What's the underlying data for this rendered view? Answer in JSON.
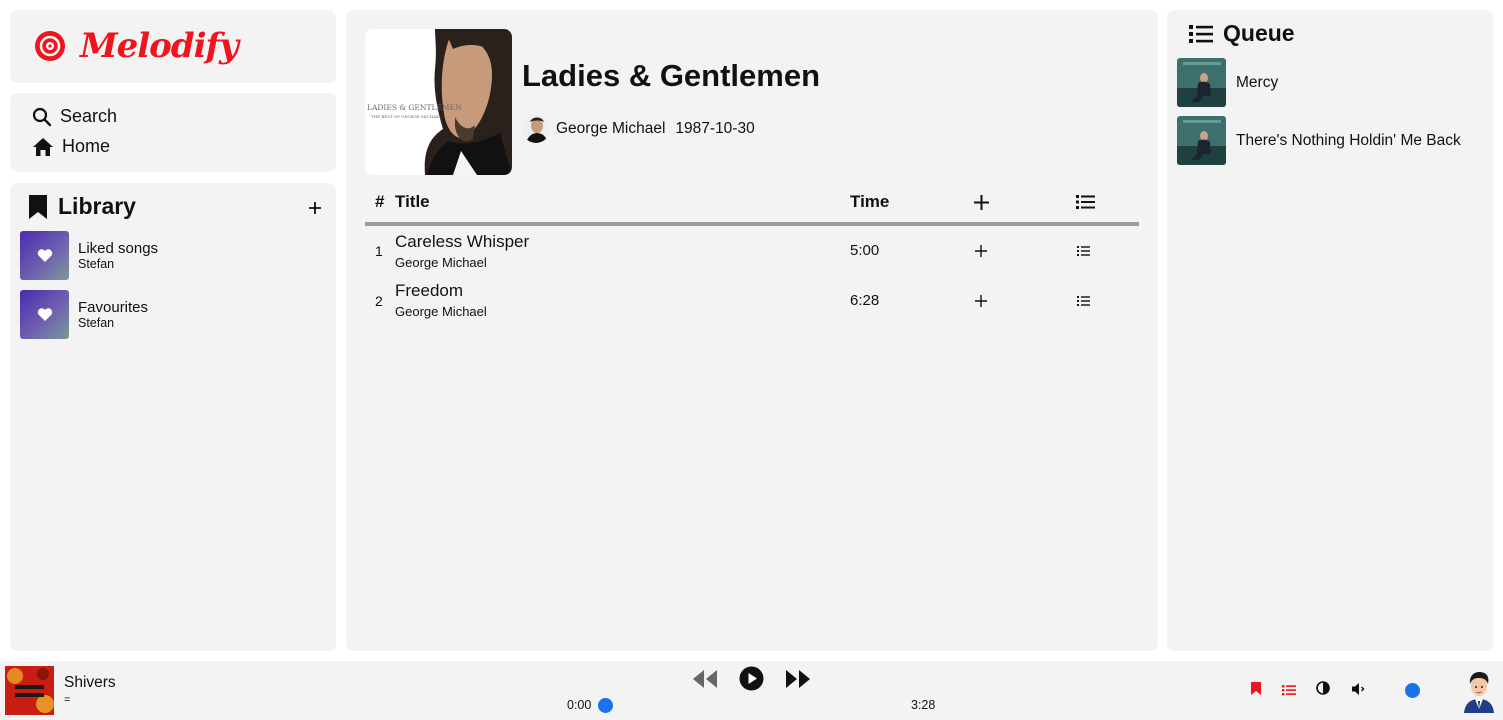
{
  "app": {
    "name": "Melodify",
    "brand_color": "#f0141e",
    "accent_color": "#1a73e8"
  },
  "nav": {
    "search_label": "Search",
    "home_label": "Home"
  },
  "library": {
    "title": "Library",
    "add_icon": "plus-icon",
    "playlists": [
      {
        "name": "Liked songs",
        "owner": "Stefan"
      },
      {
        "name": "Favourites",
        "owner": "Stefan"
      }
    ]
  },
  "album": {
    "title": "Ladies & Gentlemen",
    "artist": "George Michael",
    "release_date": "1987-10-30",
    "cover_text_1": "LADIES & GENTLEMEN",
    "cover_text_2": "THE BEST OF GEORGE MICHAEL"
  },
  "tracklist": {
    "headers": {
      "number": "#",
      "title": "Title",
      "time": "Time"
    },
    "tracks": [
      {
        "number": "1",
        "title": "Careless Whisper",
        "artist": "George Michael",
        "time": "5:00"
      },
      {
        "number": "2",
        "title": "Freedom",
        "artist": "George Michael",
        "time": "6:28"
      }
    ]
  },
  "queue": {
    "title": "Queue",
    "items": [
      {
        "title": "Mercy"
      },
      {
        "title": "There's Nothing Holdin' Me Back"
      }
    ]
  },
  "player": {
    "now_playing_title": "Shivers",
    "now_playing_artist": "=",
    "current_time": "0:00",
    "total_time": "3:28",
    "progress": 0.0
  }
}
